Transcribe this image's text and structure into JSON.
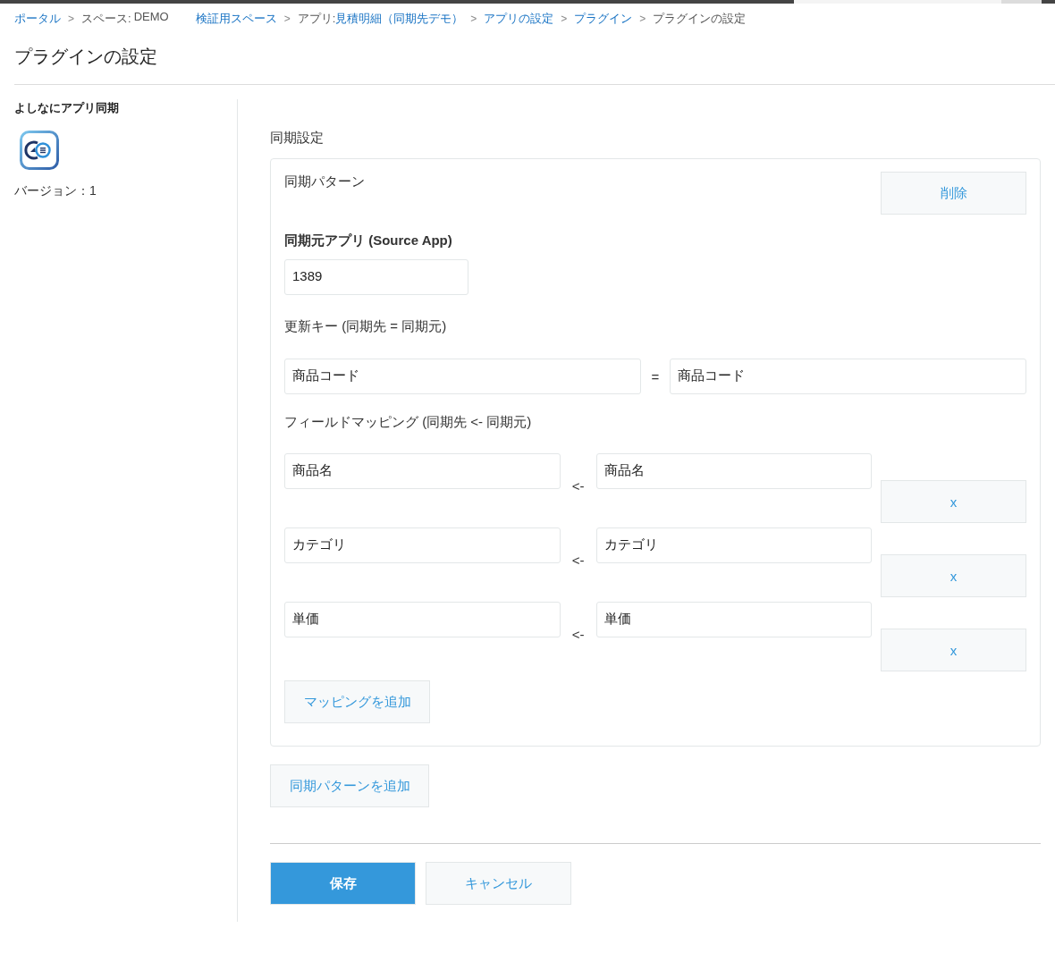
{
  "breadcrumb": [
    {
      "kind": "link",
      "text": "ポータル"
    },
    {
      "kind": "separator",
      "text": ">"
    },
    {
      "kind": "text",
      "text": "スペース:"
    },
    {
      "kind": "space",
      "text": "DEMO"
    },
    {
      "kind": "link",
      "text": "検証用スペース"
    },
    {
      "kind": "separator",
      "text": ">"
    },
    {
      "kind": "text",
      "text": "アプリ:"
    },
    {
      "kind": "link",
      "text": "見積明細（同期先デモ）"
    },
    {
      "kind": "separator",
      "text": ">"
    },
    {
      "kind": "link",
      "text": "アプリの設定"
    },
    {
      "kind": "separator",
      "text": ">"
    },
    {
      "kind": "link",
      "text": "プラグイン"
    },
    {
      "kind": "separator",
      "text": ">"
    },
    {
      "kind": "text",
      "text": "プラグインの設定"
    }
  ],
  "page_title": "プラグインの設定",
  "plugin": {
    "name": "よしなにアプリ同期",
    "version": "バージョン：1"
  },
  "section_title": "同期設定",
  "patterns": [
    {
      "title": "同期パターン",
      "delete_button": "削除",
      "source_app_label": "同期元アプリ (Source App)",
      "source_app": "1389",
      "key_label": "更新キー (同期先 = 同期元)",
      "key": {
        "dest": "商品コード",
        "operator": "=",
        "source": "商品コード"
      },
      "mapping_label": "フィールドマッピング (同期先 <- 同期元)",
      "mappings": [
        {
          "dest": "商品名",
          "arrow": "<-",
          "source": "商品名",
          "remove_button": "x"
        },
        {
          "dest": "カテゴリ",
          "arrow": "<-",
          "source": "カテゴリ",
          "remove_button": "x"
        },
        {
          "dest": "単価",
          "arrow": "<-",
          "source": "単価",
          "remove_button": "x"
        }
      ],
      "add_mapping_button": "マッピングを追加"
    }
  ],
  "add_pattern_button": "同期パターンを追加",
  "buttons": [
    {
      "kind": "primary",
      "label": "保存"
    },
    {
      "kind": "secondary",
      "label": "キャンセル"
    }
  ]
}
